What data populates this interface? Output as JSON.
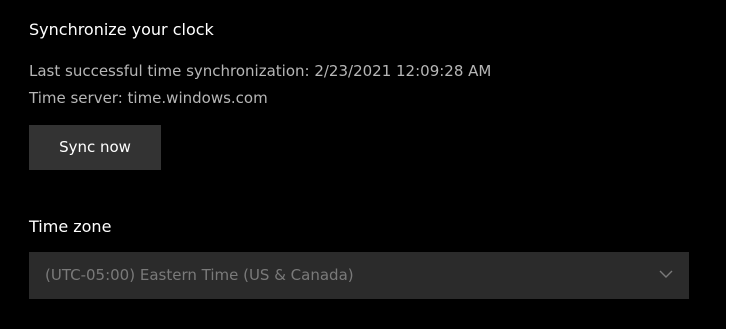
{
  "sync": {
    "title": "Synchronize your clock",
    "last_sync": "Last successful time synchronization: 2/23/2021 12:09:28 AM",
    "time_server": "Time server: time.windows.com",
    "button_label": "Sync now"
  },
  "time_zone": {
    "label": "Time zone",
    "selected": "(UTC-05:00) Eastern Time (US & Canada)",
    "chevron_icon": "chevron-down-icon"
  },
  "colors": {
    "background": "#000000",
    "button": "#333333",
    "dropdown": "#2b2b2b",
    "primary_text": "#ffffff",
    "secondary_text": "#b6b6b6",
    "disabled_text": "#7a7a7a"
  }
}
